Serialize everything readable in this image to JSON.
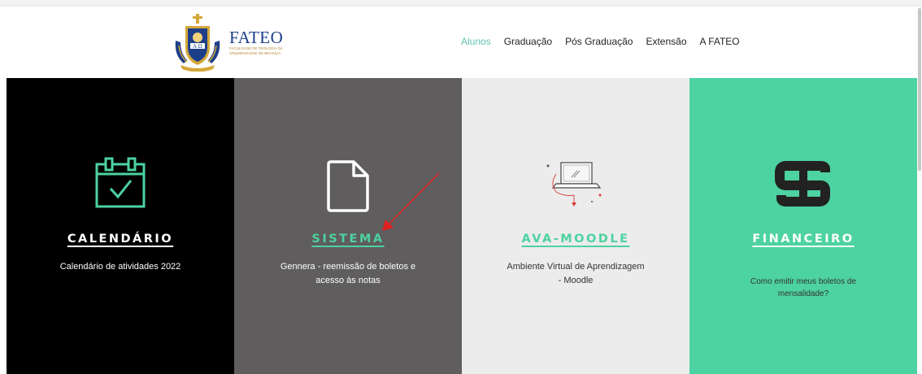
{
  "logo": {
    "name": "FATEO",
    "subtitle": "Faculdade de Teologia da Arquidiocese de Brasília",
    "crest_letters": "A Ω"
  },
  "nav": {
    "items": [
      {
        "label": "Alunos",
        "active": true
      },
      {
        "label": "Graduação",
        "active": false
      },
      {
        "label": "Pós Graduação",
        "active": false
      },
      {
        "label": "Extensão",
        "active": false
      },
      {
        "label": "A FATEO",
        "active": false
      }
    ]
  },
  "panels": [
    {
      "title": "CALENDÁRIO",
      "description": "Calendário de atividades 2022",
      "icon": "calendar-check-icon",
      "bg": "#000000"
    },
    {
      "title": "SISTEMA",
      "description": "Gennera - reemissão de boletos e acesso às notas",
      "icon": "document-icon",
      "bg": "#5f5d5d"
    },
    {
      "title": "AVA-MOODLE",
      "description": "Ambiente Virtual de Aprendizagem - Moodle",
      "icon": "laptop-icon",
      "bg": "#ececec"
    },
    {
      "title": "FINANCEIRO",
      "description": "Como emitir meus boletos de mensalidade?",
      "icon": "dollar-icon",
      "bg": "#4dd2a1"
    }
  ],
  "colors": {
    "accent": "#4dd2a1",
    "nav_active": "#5fc4b0",
    "annotation_arrow": "#e02020"
  }
}
